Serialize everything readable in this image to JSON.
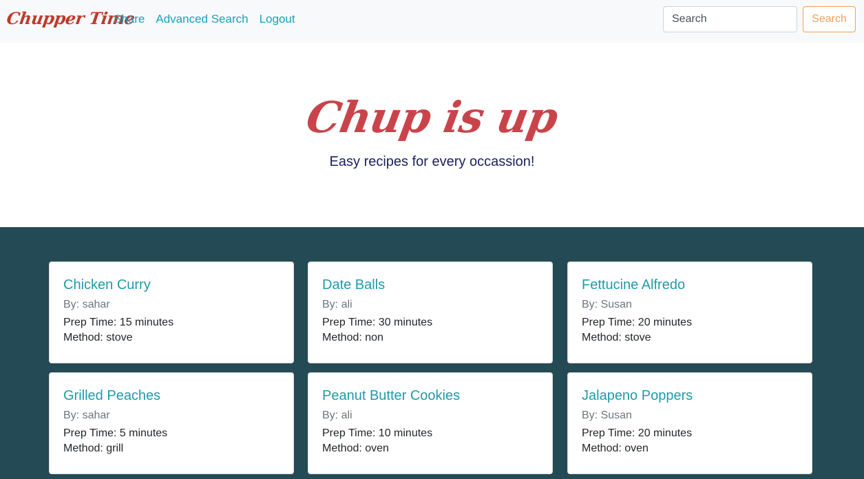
{
  "navbar": {
    "brand": "Chupper Time",
    "links": [
      "Share",
      "Advanced Search",
      "Logout"
    ],
    "search_placeholder": "Search",
    "search_button": "Search"
  },
  "hero": {
    "title": "Chup is up",
    "subtitle": "Easy recipes for every occassion!"
  },
  "recipes": [
    {
      "title": "Chicken Curry",
      "author": "By: sahar",
      "prep": "Prep Time: 15 minutes",
      "method": "Method: stove"
    },
    {
      "title": "Date Balls",
      "author": "By: ali",
      "prep": "Prep Time: 30 minutes",
      "method": "Method: non"
    },
    {
      "title": "Fettucine Alfredo",
      "author": "By: Susan",
      "prep": "Prep Time: 20 minutes",
      "method": "Method: stove"
    },
    {
      "title": "Grilled Peaches",
      "author": "By: sahar",
      "prep": "Prep Time: 5 minutes",
      "method": "Method: grill"
    },
    {
      "title": "Peanut Butter Cookies",
      "author": "By: ali",
      "prep": "Prep Time: 10 minutes",
      "method": "Method: oven"
    },
    {
      "title": "Jalapeno Poppers",
      "author": "By: Susan",
      "prep": "Prep Time: 20 minutes",
      "method": "Method: oven"
    }
  ],
  "colors": {
    "brand": "#c0392b",
    "link": "#17a2b8",
    "search_button": "#f0a05a",
    "section_bg": "#244a55",
    "subtitle": "#1a1f5e"
  }
}
